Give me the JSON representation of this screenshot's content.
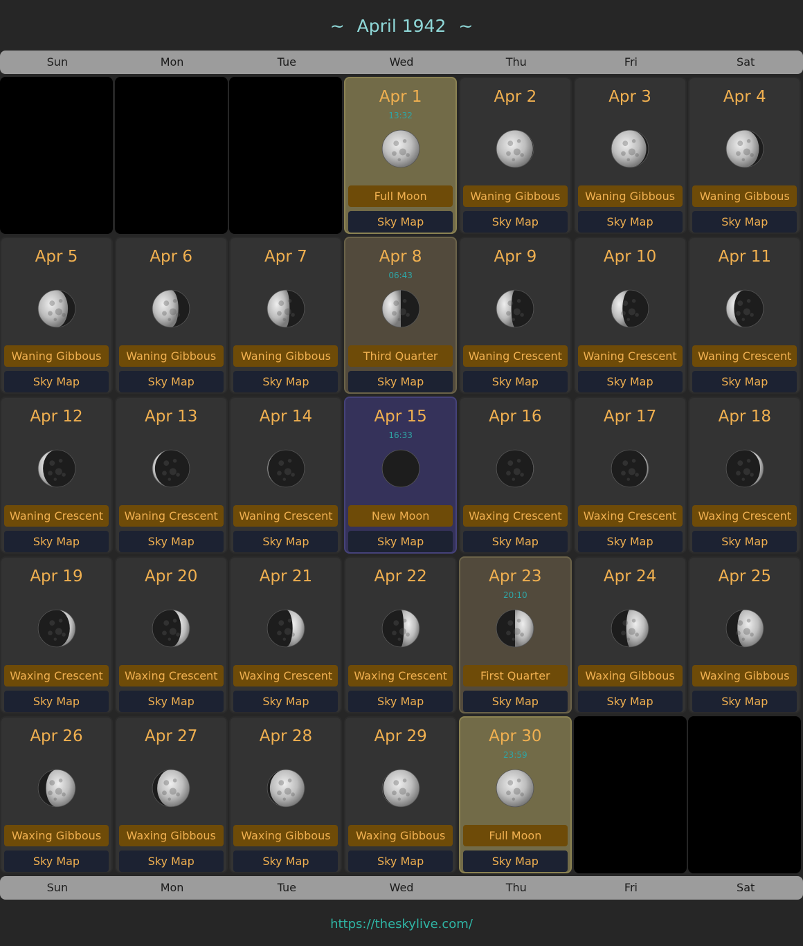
{
  "title": "April 1942",
  "title_decor": "~",
  "weekdays": [
    "Sun",
    "Mon",
    "Tue",
    "Wed",
    "Thu",
    "Fri",
    "Sat"
  ],
  "sky_map_label": "Sky Map",
  "footer_link": "https://theskylive.com/",
  "colors": {
    "accent_text": "#f0b050",
    "title": "#8fd8d8",
    "time": "#2fa5a5",
    "phase_badge": "#6e4b08",
    "sky_map_button": "#1c2232",
    "full_moon_cell": "#726b48",
    "quarter_cell": "#524a3c",
    "new_moon_cell": "#35325a"
  },
  "leading_empty_days": 3,
  "trailing_empty_days": 2,
  "days": [
    {
      "date": "Apr 1",
      "phase": "Full Moon",
      "time": "13:32",
      "illum": 1.0,
      "waxing": false,
      "highlight": "full"
    },
    {
      "date": "Apr 2",
      "phase": "Waning Gibbous",
      "illum": 0.98,
      "waxing": false
    },
    {
      "date": "Apr 3",
      "phase": "Waning Gibbous",
      "illum": 0.94,
      "waxing": false
    },
    {
      "date": "Apr 4",
      "phase": "Waning Gibbous",
      "illum": 0.88,
      "waxing": false
    },
    {
      "date": "Apr 5",
      "phase": "Waning Gibbous",
      "illum": 0.8,
      "waxing": false
    },
    {
      "date": "Apr 6",
      "phase": "Waning Gibbous",
      "illum": 0.7,
      "waxing": false
    },
    {
      "date": "Apr 7",
      "phase": "Waning Gibbous",
      "illum": 0.6,
      "waxing": false
    },
    {
      "date": "Apr 8",
      "phase": "Third Quarter",
      "time": "06:43",
      "illum": 0.5,
      "waxing": false,
      "highlight": "quarter"
    },
    {
      "date": "Apr 9",
      "phase": "Waning Crescent",
      "illum": 0.4,
      "waxing": false
    },
    {
      "date": "Apr 10",
      "phase": "Waning Crescent",
      "illum": 0.3,
      "waxing": false
    },
    {
      "date": "Apr 11",
      "phase": "Waning Crescent",
      "illum": 0.21,
      "waxing": false
    },
    {
      "date": "Apr 12",
      "phase": "Waning Crescent",
      "illum": 0.13,
      "waxing": false
    },
    {
      "date": "Apr 13",
      "phase": "Waning Crescent",
      "illum": 0.07,
      "waxing": false
    },
    {
      "date": "Apr 14",
      "phase": "Waning Crescent",
      "illum": 0.02,
      "waxing": false
    },
    {
      "date": "Apr 15",
      "phase": "New Moon",
      "time": "16:33",
      "illum": 0.0,
      "waxing": true,
      "highlight": "new"
    },
    {
      "date": "Apr 16",
      "phase": "Waxing Crescent",
      "illum": 0.01,
      "waxing": true
    },
    {
      "date": "Apr 17",
      "phase": "Waxing Crescent",
      "illum": 0.04,
      "waxing": true
    },
    {
      "date": "Apr 18",
      "phase": "Waxing Crescent",
      "illum": 0.09,
      "waxing": true
    },
    {
      "date": "Apr 19",
      "phase": "Waxing Crescent",
      "illum": 0.15,
      "waxing": true
    },
    {
      "date": "Apr 20",
      "phase": "Waxing Crescent",
      "illum": 0.23,
      "waxing": true
    },
    {
      "date": "Apr 21",
      "phase": "Waxing Crescent",
      "illum": 0.32,
      "waxing": true
    },
    {
      "date": "Apr 22",
      "phase": "Waxing Crescent",
      "illum": 0.42,
      "waxing": true
    },
    {
      "date": "Apr 23",
      "phase": "First Quarter",
      "time": "20:10",
      "illum": 0.5,
      "waxing": true,
      "highlight": "quarter"
    },
    {
      "date": "Apr 24",
      "phase": "Waxing Gibbous",
      "illum": 0.6,
      "waxing": true
    },
    {
      "date": "Apr 25",
      "phase": "Waxing Gibbous",
      "illum": 0.7,
      "waxing": true
    },
    {
      "date": "Apr 26",
      "phase": "Waxing Gibbous",
      "illum": 0.79,
      "waxing": true
    },
    {
      "date": "Apr 27",
      "phase": "Waxing Gibbous",
      "illum": 0.87,
      "waxing": true
    },
    {
      "date": "Apr 28",
      "phase": "Waxing Gibbous",
      "illum": 0.93,
      "waxing": true
    },
    {
      "date": "Apr 29",
      "phase": "Waxing Gibbous",
      "illum": 0.97,
      "waxing": true
    },
    {
      "date": "Apr 30",
      "phase": "Full Moon",
      "time": "23:59",
      "illum": 1.0,
      "waxing": true,
      "highlight": "full"
    }
  ]
}
